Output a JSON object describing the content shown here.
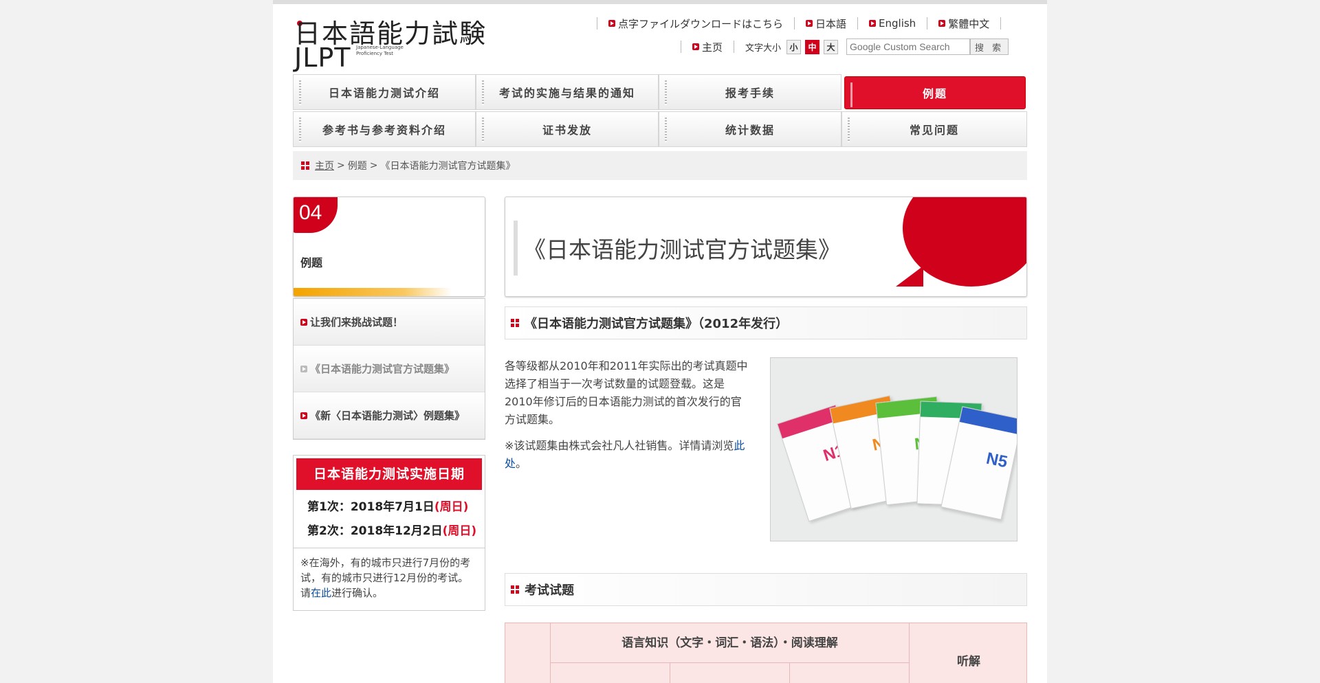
{
  "header": {
    "logo_text_jp": "日本語能力試験",
    "logo_text_en": "JLPT",
    "logo_subtitle": "Japanese-Language Proficiency Test",
    "links": [
      {
        "label": "点字ファイルダウンロードはこちら"
      },
      {
        "label": "日本語"
      },
      {
        "label": "English"
      },
      {
        "label": "繁體中文"
      }
    ],
    "home_label": "主页",
    "font_size_label": "文字大小",
    "font_sizes": [
      "小",
      "中",
      "大"
    ],
    "font_size_active": "中",
    "search_placeholder": "Google Custom Search",
    "search_button": "搜 索"
  },
  "nav": {
    "row1": [
      "日本语能力测试介绍",
      "考试的实施与结果的通知",
      "报考手续",
      "例题"
    ],
    "row2": [
      "参考书与参考资料介绍",
      "证书发放",
      "统计数据",
      "常见问题"
    ],
    "active": "例题"
  },
  "breadcrumb": {
    "home": "主页",
    "sep1": ">",
    "level1": "例题",
    "sep2": ">",
    "current": "《日本语能力测试官方试题集》"
  },
  "sidebar": {
    "number": "04",
    "title": "例题",
    "items": [
      {
        "label": "让我们来挑战试题！"
      },
      {
        "label": "《日本语能力测试官方试题集》"
      },
      {
        "label": "《新〈日本语能力测试〉例题集》"
      }
    ],
    "dates": {
      "heading": "日本语能力测试实施日期",
      "first_prefix": "第1次：2018年7月1日",
      "first_day": "(周日)",
      "second_prefix": "第2次：2018年12月2日",
      "second_day": "(周日)",
      "note_before": "※在海外，有的城市只进行7月份的考试，有的城市只进行12月份的考试。请",
      "note_link": "在此",
      "note_after": "进行确认。"
    }
  },
  "main": {
    "page_title": "《日本语能力测试官方试题集》",
    "section1_title": "《日本语能力测试官方试题集》（2012年发行）",
    "para1": "各等级都从2010年和2011年实际出的考试真题中选择了相当于一次考试数量的试题登载。这是2010年修订后的日本语能力测试的首次发行的官方试题集。",
    "para2_before": "※该试题集由株式会社凡人社销售。详情请浏览",
    "para2_link": "此处",
    "para2_after": "。",
    "book_levels": [
      "N1",
      "N2",
      "N3",
      "N4",
      "N5"
    ],
    "book_colors": [
      "#e0306a",
      "#f08a20",
      "#5bbf3c",
      "#2fae62",
      "#2f5fc8"
    ],
    "section2_title": "考试试题",
    "table": {
      "header_main": "语言知识（文字・词汇・语法）・阅读理解",
      "header_listen": "听解"
    }
  }
}
